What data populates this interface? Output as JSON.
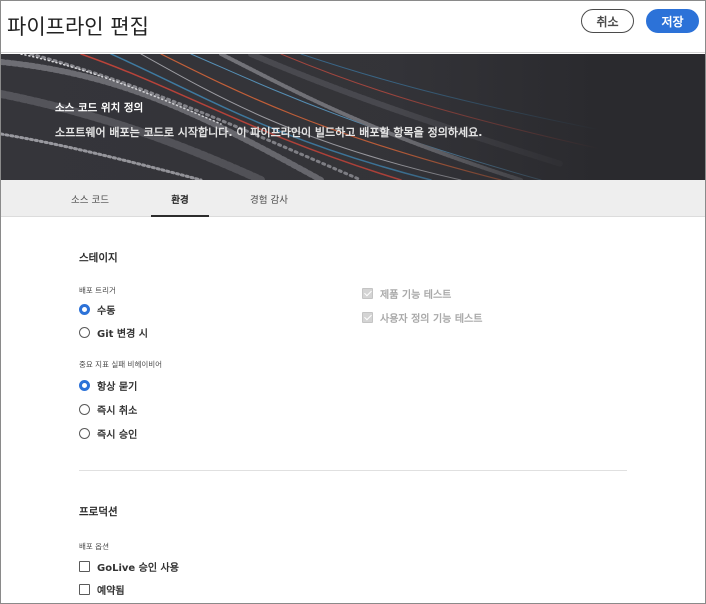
{
  "header": {
    "title": "파이프라인 편집",
    "cancel_label": "취소",
    "save_label": "저장",
    "save_color": "#2c72d8"
  },
  "banner": {
    "title": "소스 코드 위치 정의",
    "subtitle": "소프트웨어 배포는 코드로 시작합니다. 이 파이프라인이 빌드하고 배포할 항목을 정의하세요."
  },
  "tabs": [
    {
      "label": "소스 코드",
      "active": false
    },
    {
      "label": "환경",
      "active": true
    },
    {
      "label": "경험 감사",
      "active": false
    }
  ],
  "stage": {
    "section_title": "스테이지",
    "deploy_trigger": {
      "label": "배포 트리거",
      "options": [
        {
          "label": "수동",
          "checked": true
        },
        {
          "label": "Git 변경 시",
          "checked": false
        }
      ]
    },
    "important_metric_failure": {
      "label": "중요 지표 실패 비헤이비어",
      "options": [
        {
          "label": "항상 묻기",
          "checked": true
        },
        {
          "label": "즉시 취소",
          "checked": false
        },
        {
          "label": "즉시 승인",
          "checked": false
        }
      ]
    },
    "tests": [
      {
        "label": "제품 기능 테스트",
        "checked": true,
        "disabled": true
      },
      {
        "label": "사용자 정의 기능 테스트",
        "checked": true,
        "disabled": true
      }
    ]
  },
  "production": {
    "section_title": "프로덕션",
    "deploy_options": {
      "label": "배포 옵션",
      "options": [
        {
          "label": "GoLive 승인 사용",
          "checked": false
        },
        {
          "label": "예약됨",
          "checked": false
        }
      ]
    }
  }
}
